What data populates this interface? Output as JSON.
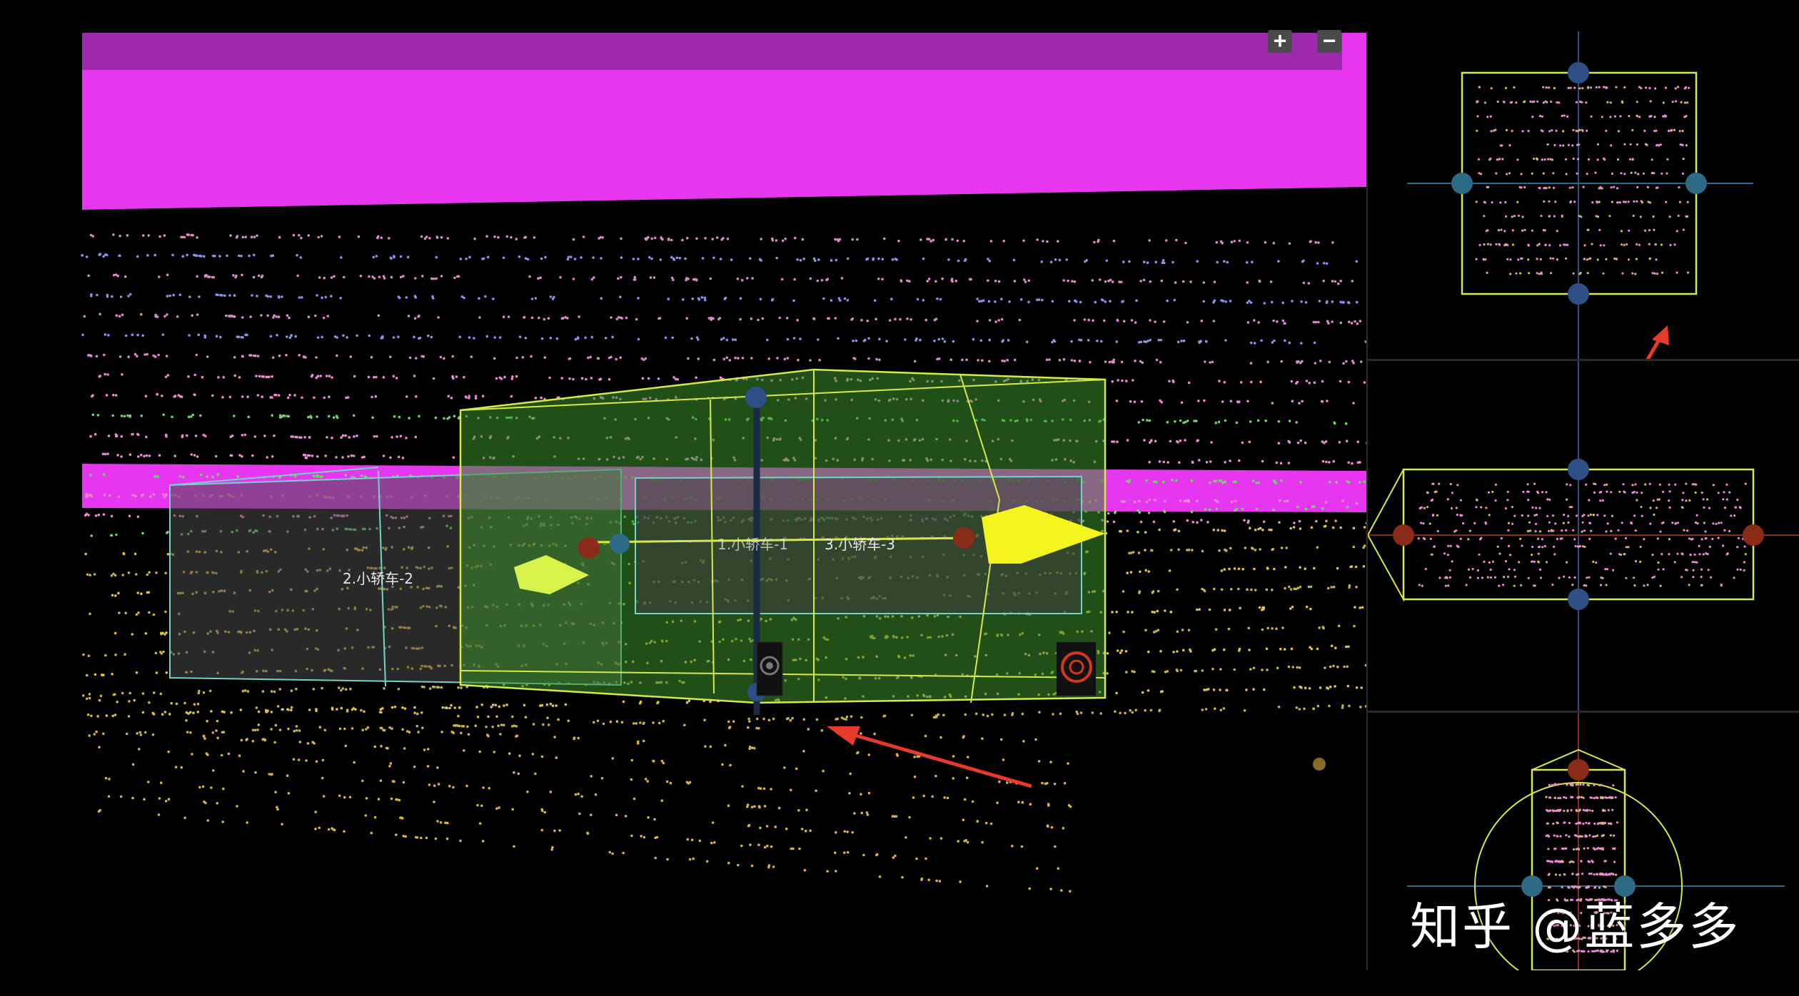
{
  "toolbar": {
    "zoom_in_label": "+",
    "zoom_out_label": "−"
  },
  "objects": [
    {
      "label": "2.小轿车-2"
    },
    {
      "label": "1.小轿车-1"
    },
    {
      "label": "3.小轿车-3"
    }
  ],
  "views": {
    "main": "3d-point-cloud-view",
    "top": "top-view",
    "side": "side-view",
    "rear": "rear-view"
  },
  "watermark": "知乎 @蓝多多",
  "colors": {
    "background": "#000000",
    "magenta_band": "#e636ef",
    "box_yellow": "#d8e84a",
    "box_fill": "#3d8f2b",
    "arrow_yellow": "#f4f41e",
    "handle_blue": "#2d4f86",
    "handle_red": "#8a2a18",
    "annotation_arrow": "#e83a2a"
  }
}
